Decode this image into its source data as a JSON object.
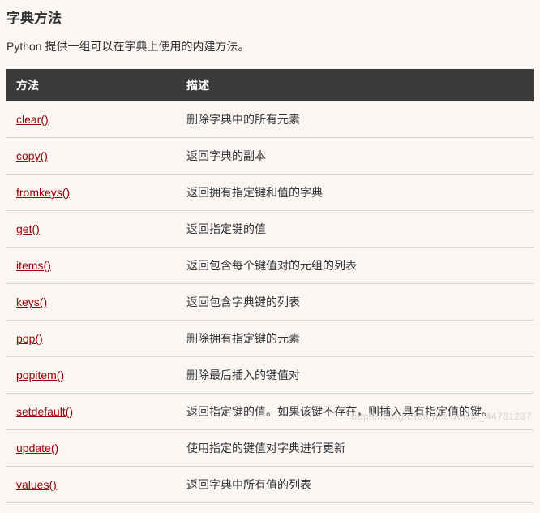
{
  "heading": "字典方法",
  "intro": "Python 提供一组可以在字典上使用的内建方法。",
  "table": {
    "headers": {
      "method": "方法",
      "description": "描述"
    },
    "rows": [
      {
        "method": "clear()",
        "description": "删除字典中的所有元素"
      },
      {
        "method": "copy()",
        "description": "返回字典的副本"
      },
      {
        "method": "fromkeys()",
        "description": "返回拥有指定键和值的字典"
      },
      {
        "method": "get()",
        "description": "返回指定键的值"
      },
      {
        "method": "items()",
        "description": "返回包含每个键值对的元组的列表"
      },
      {
        "method": "keys()",
        "description": "返回包含字典键的列表"
      },
      {
        "method": "pop()",
        "description": "删除拥有指定键的元素"
      },
      {
        "method": "popitem()",
        "description": "删除最后插入的键值对"
      },
      {
        "method": "setdefault()",
        "description": "返回指定键的值。如果该键不存在，则插入具有指定值的键。"
      },
      {
        "method": "update()",
        "description": "使用指定的键值对字典进行更新"
      },
      {
        "method": "values()",
        "description": "返回字典中所有值的列表"
      }
    ]
  },
  "watermark": "https://blog.csdn.net/weixin_44781287"
}
